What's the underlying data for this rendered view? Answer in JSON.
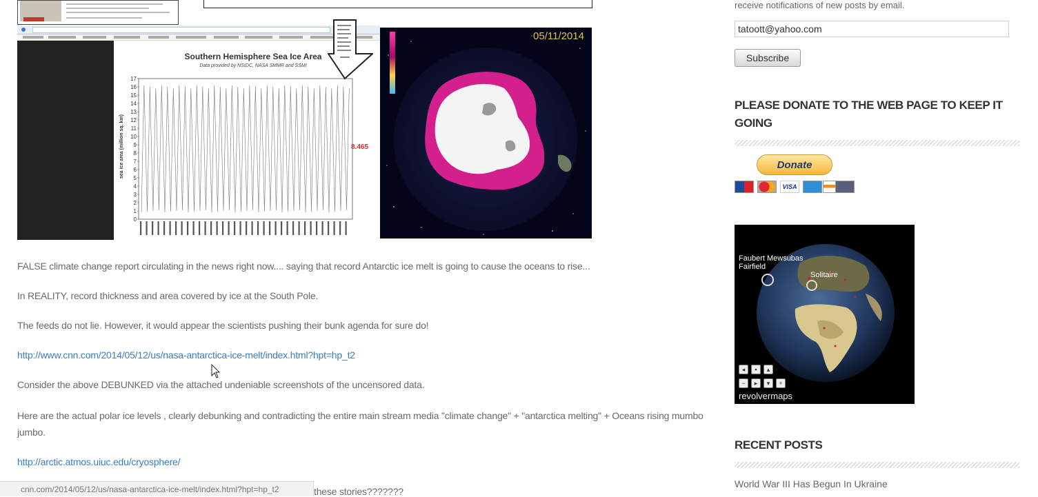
{
  "header_images": {
    "chart_title": "Southern Hemisphere Sea Ice Area",
    "chart_subtitle": "Data provided by NSIDC, NASA SMMR and SSMI",
    "chart_ylabel": "sea ice area (million sq. km)",
    "chart_yticks": [
      "17",
      "16",
      "15",
      "14",
      "13",
      "12",
      "11",
      "10",
      "9",
      "8",
      "7",
      "6",
      "5",
      "4",
      "3",
      "2",
      "1",
      "0"
    ],
    "chart_value_label": "8.465",
    "globe_date": "05/11/2014"
  },
  "article": {
    "p1": "FALSE climate change report circulating in the news right now.... saying that record Antarctic ice melt is going to cause the oceans to rise...",
    "p2": "In REALITY, record thickness and area covered by ice at the South Pole.",
    "p3": "The feeds do not lie. However, it would appear the scientists pushing their bunk agenda for sure do!",
    "link1": "http://www.cnn.com/2014/05/12/us/nasa-antarctica-ice-melt/index.html?hpt=hp_t2",
    "p4": "Consider the above DEBUNKED via the attached undeniable screenshots of the uncensored data.",
    "p5": "Here are the actual polar ice levels , clearly debunking and contradicting the entire main stream media \"climate change\" + \"antarctica melting\" + Oceans rising mumbo jumbo.",
    "link2": "http://arctic.atmos.uiuc.edu/cryosphere/",
    "p6_tail": "these stories???????"
  },
  "status_bar": {
    "url": "cnn.com/2014/05/12/us/nasa-antarctica-ice-melt/index.html?hpt=hp_t2"
  },
  "sidebar": {
    "notify_text": "receive notifications of new posts by email.",
    "email_value": "tatoott@yahoo.com",
    "subscribe_label": "Subscribe",
    "donate_heading": "PLEASE DONATE TO THE WEB PAGE TO KEEP IT GOING",
    "donate_label": "Donate",
    "revolver_brand": "revolvermaps",
    "revolver_places": [
      "Faubert Mewsubas",
      "Fairfield",
      "Solitaire"
    ],
    "recent_heading": "RECENT POSTS",
    "recent_posts": [
      "World War III Has Begun In Ukraine"
    ]
  },
  "colors": {
    "link": "#3a7cc3",
    "text": "#6a6a6a",
    "heading": "#333333",
    "donate_gold": "#f6b73c",
    "ice_magenta": "#d4208c"
  }
}
